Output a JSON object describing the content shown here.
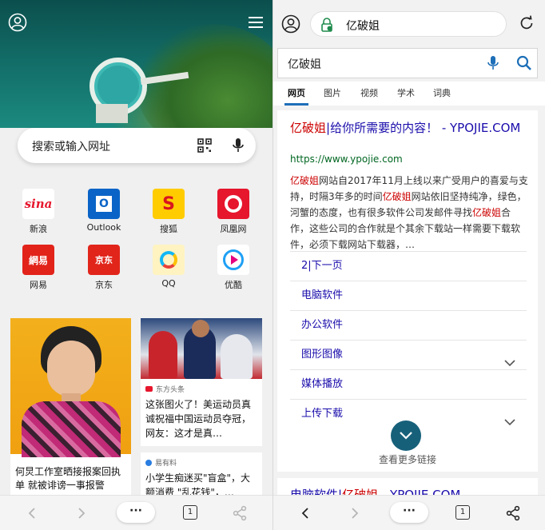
{
  "left": {
    "search_placeholder": "搜索或输入网址",
    "shortcuts": [
      {
        "label": "新浪",
        "icon": "sina-icon",
        "glyph": "sina"
      },
      {
        "label": "Outlook",
        "icon": "outlook-icon",
        "glyph": "O"
      },
      {
        "label": "搜狐",
        "icon": "sohu-icon",
        "glyph": "S"
      },
      {
        "label": "凤凰网",
        "icon": "ifeng-icon",
        "glyph": ""
      },
      {
        "label": "网易",
        "icon": "netease-icon",
        "glyph": "網易"
      },
      {
        "label": "京东",
        "icon": "jd-icon",
        "glyph": "京东"
      },
      {
        "label": "QQ",
        "icon": "qq-icon",
        "glyph": ""
      },
      {
        "label": "优酷",
        "icon": "youku-icon",
        "glyph": ""
      }
    ],
    "feed": {
      "card1_title": "何炅工作室晒接报案回执单 就被诽谤一事报警",
      "card2_source": "东方头条",
      "card2_title": "这张图火了！美运动员真诚祝福中国运动员夺冠，网友：这才是真…",
      "card3_source": "易有料",
      "card3_title": "小学生痴迷买\"盲盒\"，大额消费 \"乱花钱\"，…"
    },
    "bottom_bar": {
      "menu_label": "···",
      "tab_count": "1"
    }
  },
  "right": {
    "address_text": "亿破姐",
    "search_query": "亿破姐",
    "tabs": [
      "网页",
      "图片",
      "视频",
      "学术",
      "词典"
    ],
    "result": {
      "title_highlight": "亿破姐",
      "title_rest": "|给你所需要的内容！ - YPOJIE.COM",
      "url": "https://www.ypojie.com",
      "snippet_parts": [
        {
          "t": "亿破姐",
          "hl": true
        },
        {
          "t": "网站自2017年11月上线以来广受用户的喜爱与支持，时隔3年多的时间",
          "hl": false
        },
        {
          "t": "亿破姐",
          "hl": true
        },
        {
          "t": "网站依旧坚持纯净，绿色，河蟹的态度，也有很多软件公司发邮件寻找",
          "hl": false
        },
        {
          "t": "亿破姐",
          "hl": true
        },
        {
          "t": "合作，这些公司的合作就是个其余下载站一样需要下载软件，必须下载网站下载器，…",
          "hl": false
        }
      ],
      "sitelinks": [
        {
          "label": "2|下一页",
          "expandable": false
        },
        {
          "label": "电脑软件",
          "expandable": false
        },
        {
          "label": "办公软件",
          "expandable": false
        },
        {
          "label": "图形图像",
          "expandable": true
        },
        {
          "label": "媒体播放",
          "expandable": false
        },
        {
          "label": "上传下载",
          "expandable": true
        }
      ],
      "more_label": "查看更多链接"
    },
    "next_result": {
      "title_part1": "电脑软件|",
      "title_highlight": "亿破姐",
      "title_part2": " - YPOJIE.COM"
    },
    "bottom_bar": {
      "menu_label": "···",
      "tab_count": "1"
    }
  },
  "colors": {
    "link": "#1a0dab",
    "highlight": "#cc0000",
    "url_green": "#006621",
    "accent_teal": "#17607a",
    "tab_underline": "#1d6fb8"
  }
}
